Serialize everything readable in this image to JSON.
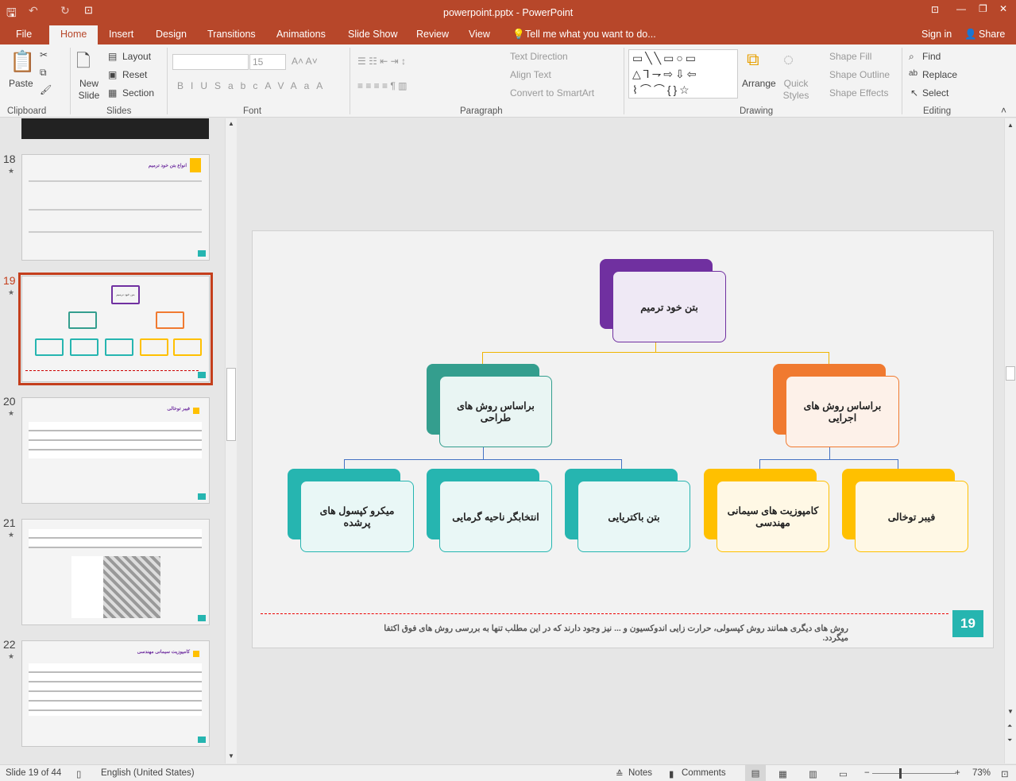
{
  "title": "powerpoint.pptx - PowerPoint",
  "tabs": {
    "file": "File",
    "home": "Home",
    "insert": "Insert",
    "design": "Design",
    "transitions": "Transitions",
    "animations": "Animations",
    "slideshow": "Slide Show",
    "review": "Review",
    "view": "View",
    "tellme": "Tell me what you want to do...",
    "signin": "Sign in",
    "share": "Share"
  },
  "ribbon": {
    "clipboard": {
      "paste": "Paste",
      "label": "Clipboard"
    },
    "slides": {
      "new_slide": "New Slide",
      "layout": "Layout",
      "reset": "Reset",
      "section": "Section",
      "label": "Slides"
    },
    "font": {
      "size": "15",
      "label": "Font"
    },
    "paragraph": {
      "text_direction": "Text Direction",
      "align_text": "Align Text",
      "smartart": "Convert to SmartArt",
      "label": "Paragraph"
    },
    "drawing": {
      "arrange": "Arrange",
      "quick_styles": "Quick Styles",
      "shape_fill": "Shape Fill",
      "shape_outline": "Shape Outline",
      "shape_effects": "Shape Effects",
      "label": "Drawing"
    },
    "editing": {
      "find": "Find",
      "replace": "Replace",
      "select": "Select",
      "label": "Editing"
    }
  },
  "thumbnails": [
    {
      "num": "18",
      "title": "انواع بتن خود ترمیم"
    },
    {
      "num": "19",
      "title": "بتن خود ترمیم"
    },
    {
      "num": "20",
      "title": "فیبر توخالی"
    },
    {
      "num": "21",
      "title": ""
    },
    {
      "num": "22",
      "title": "کامپوزیت سیمانی مهندسی"
    }
  ],
  "slide": {
    "root": "بتن خود ترمیم",
    "mid_left": "براساس روش های طراحی",
    "mid_right": "براساس روش های اجرایی",
    "leaves": [
      "میکرو کپسول های پرشده",
      "انتخابگر ناحیه گرمایی",
      "بتن باکتریایی",
      "کامپوزیت های سیمانی مهندسی",
      "فیبر توخالی"
    ],
    "footnote": "روش های دیگری همانند روش کپسولی، حرارت زایی اندوکسیون و ... نیز وجود دارند که در این مطلب تنها به بررسی روش های فوق اکتفا میگردد.",
    "number": "19",
    "colors": {
      "purple": "#7030a0",
      "teal": "#26b5b0",
      "dark_teal": "#349e8e",
      "orange": "#f07a30",
      "yellow": "#ffc000"
    }
  },
  "status": {
    "slide": "Slide 19 of 44",
    "language": "English (United States)",
    "notes": "Notes",
    "comments": "Comments",
    "zoom": "73%"
  }
}
